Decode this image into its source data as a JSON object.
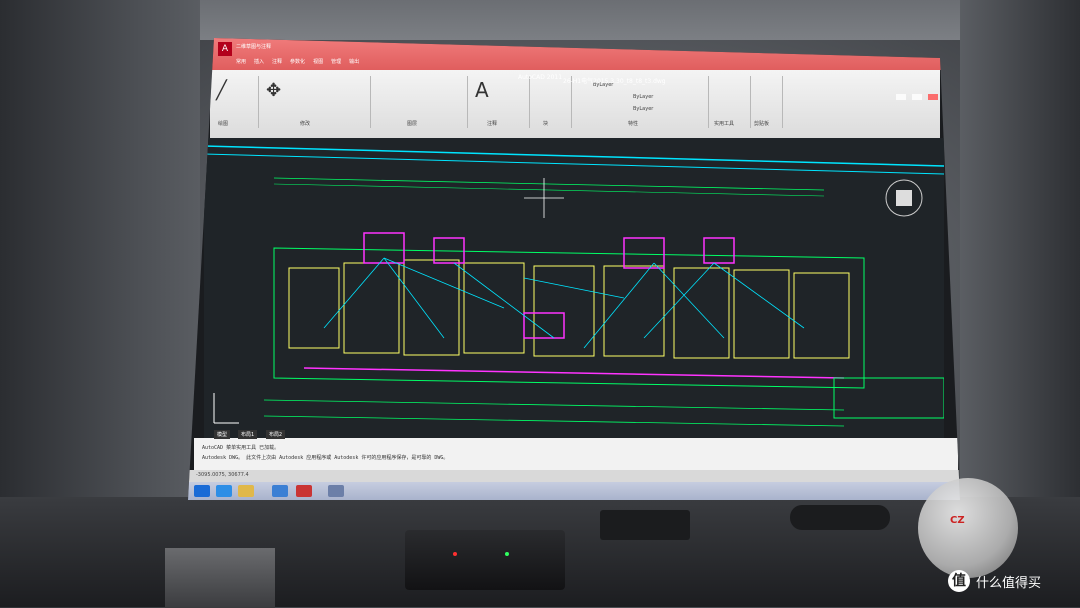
{
  "app": {
    "name": "AutoCAD 2011",
    "filename": "26-H1电气2015.3.30_t8_t8_t3.dwg",
    "quick_access": "二维草图与注释"
  },
  "ribbon_tabs": [
    "常用",
    "插入",
    "注释",
    "参数化",
    "视图",
    "管理",
    "输出"
  ],
  "ribbon_groups": [
    {
      "label": "绘图"
    },
    {
      "label": "修改"
    },
    {
      "label": "图层"
    },
    {
      "label": "注释"
    },
    {
      "label": "块"
    },
    {
      "label": "特性"
    },
    {
      "label": "实用工具"
    },
    {
      "label": "剪贴板"
    }
  ],
  "properties": {
    "layer_1": "ByLayer",
    "layer_2": "ByLayer",
    "layer_3": "ByLayer"
  },
  "command": {
    "tabs": [
      "模型",
      "布局1",
      "布局2"
    ],
    "line1": "AutoCAD 菜单实用工具 已加载。",
    "line2": "Autodesk DWG。 此文件上次由 Autodesk 应用程序或 Autodesk 许可的应用程序保存，是可靠的 DWG。"
  },
  "status": {
    "coords": "-3095.0075, 30677.4"
  },
  "viewport": {
    "bg_color": "#1f2428",
    "drawing_colors": [
      "#00e5ff",
      "#ff33ff",
      "#ffff66",
      "#00ff66",
      "#ffffff"
    ]
  },
  "watermark": {
    "icon": "值",
    "text": "什么值得买"
  },
  "ball_mark": "CZ"
}
